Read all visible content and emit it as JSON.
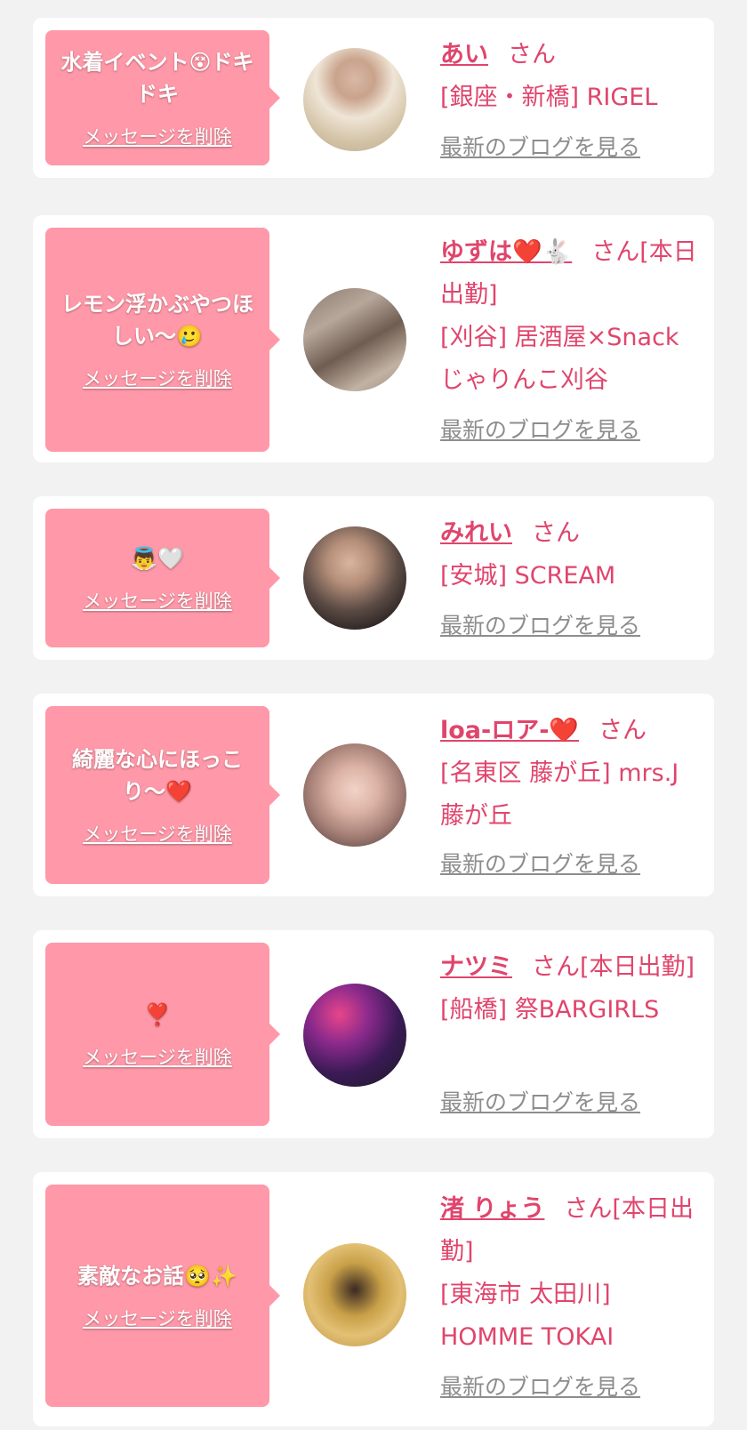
{
  "labels": {
    "delete": "メッセージを削除",
    "blog": "最新のブログを見る",
    "san": "さん"
  },
  "colors": {
    "accent": "#e0456c",
    "bubble": "#ff98a8",
    "card": "#ffffff",
    "background": "#f2f2f2",
    "link_gray": "#8d8d8d"
  },
  "cards": [
    {
      "message": "水着イベント😵ドキドキ",
      "name": "あい",
      "suffix": "",
      "shop": "[銀座・新橋] RIGEL"
    },
    {
      "message": "レモン浮かぶやつほしい〜🥲",
      "name": "ゆずは❤️🐇",
      "suffix": "[本日出勤]",
      "shop": "[刈谷] 居酒屋×Snack じゃりんこ刈谷"
    },
    {
      "message": "👼🤍",
      "name": "みれい",
      "suffix": "",
      "shop": "[安城] SCREAM"
    },
    {
      "message": "綺麗な心にほっこり〜❤️",
      "name": "loa-ロア-❤️",
      "suffix": "",
      "shop": "[名東区 藤が丘] mrs.J 藤が丘"
    },
    {
      "message": "❣️",
      "name": "ナツミ",
      "suffix": "[本日出勤]",
      "shop": "[船橋] 祭BARGIRLS"
    },
    {
      "message": "素敵なお話🥺✨",
      "name": "渚 りょう",
      "suffix": "[本日出勤]",
      "shop": "[東海市 太田川] HOMME TOKAI"
    }
  ]
}
